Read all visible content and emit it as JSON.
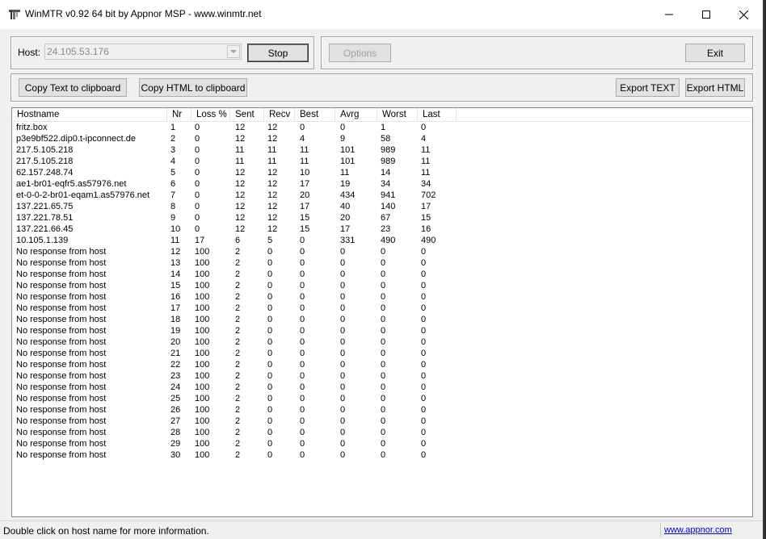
{
  "window": {
    "title": "WinMTR v0.92 64 bit by Appnor MSP - www.winmtr.net",
    "app_icon": "winmtr-icon"
  },
  "toolbar": {
    "host_label": "Host:",
    "host_value": "24.105.53.176",
    "stop_label": "Stop",
    "options_label": "Options",
    "exit_label": "Exit",
    "copy_text_label": "Copy Text to clipboard",
    "copy_html_label": "Copy HTML to clipboard",
    "export_text_label": "Export TEXT",
    "export_html_label": "Export HTML"
  },
  "table": {
    "columns": [
      "Hostname",
      "Nr",
      "Loss %",
      "Sent",
      "Recv",
      "Best",
      "Avrg",
      "Worst",
      "Last"
    ],
    "rows": [
      [
        "fritz.box",
        "1",
        "0",
        "12",
        "12",
        "0",
        "0",
        "1",
        "0"
      ],
      [
        "p3e9bf522.dip0.t-ipconnect.de",
        "2",
        "0",
        "12",
        "12",
        "4",
        "9",
        "58",
        "4"
      ],
      [
        "217.5.105.218",
        "3",
        "0",
        "11",
        "11",
        "11",
        "101",
        "989",
        "11"
      ],
      [
        "217.5.105.218",
        "4",
        "0",
        "11",
        "11",
        "11",
        "101",
        "989",
        "11"
      ],
      [
        "62.157.248.74",
        "5",
        "0",
        "12",
        "12",
        "10",
        "11",
        "14",
        "11"
      ],
      [
        "ae1-br01-eqfr5.as57976.net",
        "6",
        "0",
        "12",
        "12",
        "17",
        "19",
        "34",
        "34"
      ],
      [
        "et-0-0-2-br01-eqam1.as57976.net",
        "7",
        "0",
        "12",
        "12",
        "20",
        "434",
        "941",
        "702"
      ],
      [
        "137.221.65.75",
        "8",
        "0",
        "12",
        "12",
        "17",
        "40",
        "140",
        "17"
      ],
      [
        "137.221.78.51",
        "9",
        "0",
        "12",
        "12",
        "15",
        "20",
        "67",
        "15"
      ],
      [
        "137.221.66.45",
        "10",
        "0",
        "12",
        "12",
        "15",
        "17",
        "23",
        "16"
      ],
      [
        "10.105.1.139",
        "11",
        "17",
        "6",
        "5",
        "0",
        "331",
        "490",
        "490"
      ],
      [
        "No response from host",
        "12",
        "100",
        "2",
        "0",
        "0",
        "0",
        "0",
        "0"
      ],
      [
        "No response from host",
        "13",
        "100",
        "2",
        "0",
        "0",
        "0",
        "0",
        "0"
      ],
      [
        "No response from host",
        "14",
        "100",
        "2",
        "0",
        "0",
        "0",
        "0",
        "0"
      ],
      [
        "No response from host",
        "15",
        "100",
        "2",
        "0",
        "0",
        "0",
        "0",
        "0"
      ],
      [
        "No response from host",
        "16",
        "100",
        "2",
        "0",
        "0",
        "0",
        "0",
        "0"
      ],
      [
        "No response from host",
        "17",
        "100",
        "2",
        "0",
        "0",
        "0",
        "0",
        "0"
      ],
      [
        "No response from host",
        "18",
        "100",
        "2",
        "0",
        "0",
        "0",
        "0",
        "0"
      ],
      [
        "No response from host",
        "19",
        "100",
        "2",
        "0",
        "0",
        "0",
        "0",
        "0"
      ],
      [
        "No response from host",
        "20",
        "100",
        "2",
        "0",
        "0",
        "0",
        "0",
        "0"
      ],
      [
        "No response from host",
        "21",
        "100",
        "2",
        "0",
        "0",
        "0",
        "0",
        "0"
      ],
      [
        "No response from host",
        "22",
        "100",
        "2",
        "0",
        "0",
        "0",
        "0",
        "0"
      ],
      [
        "No response from host",
        "23",
        "100",
        "2",
        "0",
        "0",
        "0",
        "0",
        "0"
      ],
      [
        "No response from host",
        "24",
        "100",
        "2",
        "0",
        "0",
        "0",
        "0",
        "0"
      ],
      [
        "No response from host",
        "25",
        "100",
        "2",
        "0",
        "0",
        "0",
        "0",
        "0"
      ],
      [
        "No response from host",
        "26",
        "100",
        "2",
        "0",
        "0",
        "0",
        "0",
        "0"
      ],
      [
        "No response from host",
        "27",
        "100",
        "2",
        "0",
        "0",
        "0",
        "0",
        "0"
      ],
      [
        "No response from host",
        "28",
        "100",
        "2",
        "0",
        "0",
        "0",
        "0",
        "0"
      ],
      [
        "No response from host",
        "29",
        "100",
        "2",
        "0",
        "0",
        "0",
        "0",
        "0"
      ],
      [
        "No response from host",
        "30",
        "100",
        "2",
        "0",
        "0",
        "0",
        "0",
        "0"
      ]
    ]
  },
  "statusbar": {
    "text": "Double click on host name for more information.",
    "link": "www.appnor.com"
  },
  "colors": {
    "window_bg": "#f0f0f0",
    "link": "#0000ee",
    "disabled_text": "#a0a0a0"
  }
}
